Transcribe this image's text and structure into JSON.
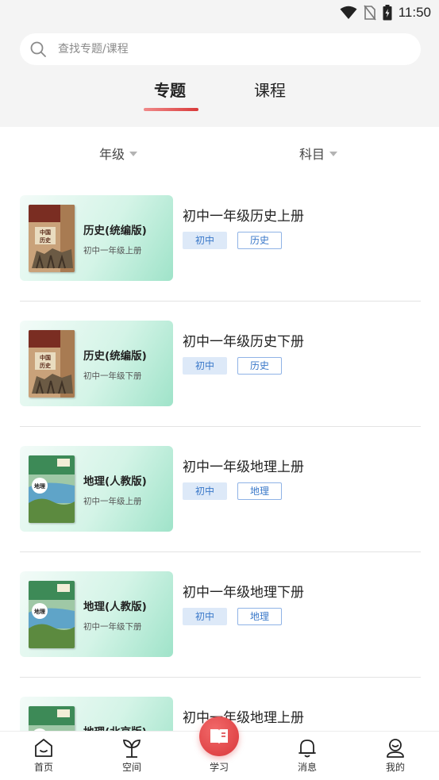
{
  "status_bar": {
    "time": "11:50",
    "icons": [
      "wifi-icon",
      "no-sim-icon",
      "battery-charging-icon"
    ]
  },
  "search": {
    "placeholder": "查找专题/课程",
    "icon": "search-icon"
  },
  "tabs": [
    {
      "label": "专题",
      "active": true
    },
    {
      "label": "课程",
      "active": false
    }
  ],
  "filters": [
    {
      "label": "年级"
    },
    {
      "label": "科目"
    }
  ],
  "items": [
    {
      "book": "history",
      "card_title": "历史(统编版)",
      "card_sub": "初中一年级上册",
      "title": "初中一年级历史上册",
      "level_tag": "初中",
      "subject_tag": "历史"
    },
    {
      "book": "history",
      "card_title": "历史(统编版)",
      "card_sub": "初中一年级下册",
      "title": "初中一年级历史下册",
      "level_tag": "初中",
      "subject_tag": "历史"
    },
    {
      "book": "geography",
      "card_title": "地理(人教版)",
      "card_sub": "初中一年级上册",
      "title": "初中一年级地理上册",
      "level_tag": "初中",
      "subject_tag": "地理"
    },
    {
      "book": "geography",
      "card_title": "地理(人教版)",
      "card_sub": "初中一年级下册",
      "title": "初中一年级地理下册",
      "level_tag": "初中",
      "subject_tag": "地理"
    },
    {
      "book": "geography",
      "card_title": "地理(北京版)",
      "card_sub": "",
      "title": "初中一年级地理上册",
      "level_tag": "",
      "subject_tag": ""
    }
  ],
  "bottom_nav": [
    {
      "label": "首页",
      "icon": "home-icon"
    },
    {
      "label": "空间",
      "icon": "sprout-icon"
    },
    {
      "label": "学习",
      "icon": "book-icon"
    },
    {
      "label": "消息",
      "icon": "bell-icon"
    },
    {
      "label": "我的",
      "icon": "user-icon"
    }
  ],
  "colors": {
    "accent": "#d93a3a",
    "tag_blue": "#3a78c9",
    "tag_bg": "#dde9f8",
    "card_green": "#9fe3c9"
  }
}
